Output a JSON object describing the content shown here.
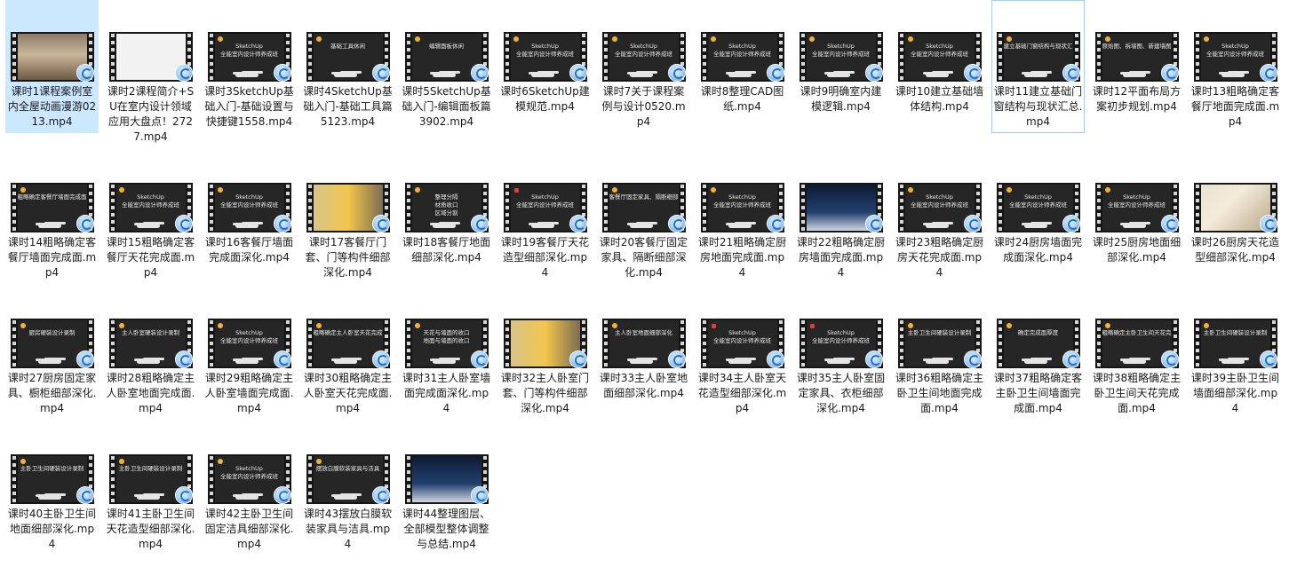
{
  "files": [
    {
      "name": "课时1课程案例室内全屋动画漫游0213.mp4",
      "thumb": "photo",
      "overlay": [],
      "badge_icon": "video-overlay-icon",
      "selected": true
    },
    {
      "name": "课时2课程简介+SU在室内设计领域应用大盘点！2727.mp4",
      "thumb": "web",
      "overlay": [],
      "badge_icon": "video-overlay-icon"
    },
    {
      "name": "课时3SketchUp基础入门-基础设置与快捷键1558.mp4",
      "thumb": "dark",
      "overlay": [
        "SketchUp",
        "全能室内设计师养成班"
      ],
      "badge_icon": "video-overlay-icon"
    },
    {
      "name": "课时4SketchUp基础入门-基础工具篇5123.mp4",
      "thumb": "dark",
      "overlay": [
        "基础工具休闲"
      ],
      "badge_icon": "video-overlay-icon"
    },
    {
      "name": "课时5SketchUp基础入门-编辑面板篇3902.mp4",
      "thumb": "dark",
      "overlay": [
        "编辑面板休闲"
      ],
      "badge_icon": "video-overlay-icon"
    },
    {
      "name": "课时6SketchUp建模规范.mp4",
      "thumb": "dark",
      "overlay": [
        "SketchUp",
        "全能室内设计师养成班"
      ],
      "badge_icon": "video-overlay-icon"
    },
    {
      "name": "课时7关于课程案例与设计0520.mp4",
      "thumb": "dark",
      "overlay": [
        "SketchUp",
        "全能室内设计师养成班"
      ],
      "badge_icon": "video-overlay-icon"
    },
    {
      "name": "课时8整理CAD图纸.mp4",
      "thumb": "dark",
      "overlay": [
        "SketchUp",
        "全能室内设计师养成班"
      ],
      "badge_icon": "video-overlay-icon"
    },
    {
      "name": "课时9明确室内建模逻辑.mp4",
      "thumb": "dark",
      "overlay": [
        "SketchUp",
        "全能室内设计师养成班"
      ],
      "badge_icon": "video-overlay-icon"
    },
    {
      "name": "课时10建立基础墙体结构.mp4",
      "thumb": "dark",
      "overlay": [
        "SketchUp",
        "全能室内设计师养成班"
      ],
      "badge_icon": "video-overlay-icon"
    },
    {
      "name": "课时11建立基础门窗结构与现状汇总.mp4",
      "thumb": "dark",
      "overlay": [
        "建立基础门窗结构与现状汇总"
      ],
      "badge_icon": "video-overlay-icon",
      "focused": true
    },
    {
      "name": "课时12平面布局方案初步规划.mp4",
      "thumb": "dark",
      "overlay": [
        "原始图、拆墙图、新建墙图"
      ],
      "badge_icon": "video-overlay-icon"
    },
    {
      "name": "课时13粗略确定客餐厅地面完成面.mp4",
      "thumb": "dark",
      "overlay": [
        "SketchUp",
        "全能室内设计师养成班"
      ],
      "badge_icon": "video-overlay-icon"
    },
    {
      "name": "课时14粗略确定客餐厅墙面完成面.mp4",
      "thumb": "dark",
      "overlay": [
        "粗略确定客餐厅墙面完成面"
      ],
      "badge_icon": "video-overlay-icon"
    },
    {
      "name": "课时15粗略确定客餐厅天花完成面.mp4",
      "thumb": "dark",
      "overlay": [
        "SketchUp",
        "全能室内设计师养成班"
      ],
      "badge_icon": "video-overlay-icon"
    },
    {
      "name": "课时16客餐厅墙面完成面深化.mp4",
      "thumb": "dark",
      "overlay": [
        "SketchUp",
        "全能室内设计师养成班"
      ],
      "badge_icon": "video-overlay-icon"
    },
    {
      "name": "课时17客餐厅门套、门等构件细部深化.mp4",
      "thumb": "photo3",
      "overlay": [],
      "badge_icon": "video-overlay-icon"
    },
    {
      "name": "课时18客餐厅地面细部深化.mp4",
      "thumb": "dark",
      "overlay": [
        "整理分隔",
        "材质收口",
        "区域分割"
      ],
      "badge_icon": "video-overlay-icon"
    },
    {
      "name": "课时19客餐厅天花造型细部深化.mp4",
      "thumb": "dark",
      "overlay": [
        "SketchUp",
        "全能室内设计师养成班"
      ],
      "badge_icon": "video-overlay-icon",
      "logo": true
    },
    {
      "name": "课时20客餐厅固定家具、隔断细部深化.mp4",
      "thumb": "dark",
      "overlay": [
        "客餐厅固定家具、隔断细部深化"
      ],
      "badge_icon": "video-overlay-icon"
    },
    {
      "name": "课时21粗略确定厨房地面完成面.mp4",
      "thumb": "dark",
      "overlay": [
        "SketchUp",
        "全能室内设计师养成班"
      ],
      "badge_icon": "video-overlay-icon"
    },
    {
      "name": "课时22粗略确定厨房墙面完成面.mp4",
      "thumb": "screen",
      "overlay": [],
      "badge_icon": "video-overlay-icon"
    },
    {
      "name": "课时23粗略确定厨房天花完成面.mp4",
      "thumb": "dark",
      "overlay": [
        "SketchUp",
        "全能室内设计师养成班"
      ],
      "badge_icon": "video-overlay-icon"
    },
    {
      "name": "课时24厨房墙面完成面深化.mp4",
      "thumb": "dark",
      "overlay": [
        "SketchUp",
        "全能室内设计师养成班"
      ],
      "badge_icon": "video-overlay-icon"
    },
    {
      "name": "课时25厨房地面细部深化.mp4",
      "thumb": "dark",
      "overlay": [
        "SketchUp",
        "全能室内设计师养成班"
      ],
      "badge_icon": "video-overlay-icon"
    },
    {
      "name": "课时26厨房天花造型细部深化.mp4",
      "thumb": "photo2",
      "overlay": [],
      "badge_icon": "video-overlay-icon"
    },
    {
      "name": "课时27厨房固定家具、橱柜细部深化.mp4",
      "thumb": "dark",
      "overlay": [
        "厨房硬装设计录制"
      ],
      "badge_icon": "video-overlay-icon"
    },
    {
      "name": "课时28粗略确定主人卧室地面完成面.mp4",
      "thumb": "dark",
      "overlay": [
        "主人卧室硬装设计录制"
      ],
      "badge_icon": "video-overlay-icon"
    },
    {
      "name": "课时29粗略确定主人卧室墙面完成面.mp4",
      "thumb": "dark",
      "overlay": [
        "SketchUp",
        "全能室内设计师养成班"
      ],
      "badge_icon": "video-overlay-icon"
    },
    {
      "name": "课时30粗略确定主人卧室天花完成面.mp4",
      "thumb": "dark",
      "overlay": [
        "粗略确定主人卧室天花完成面"
      ],
      "badge_icon": "video-overlay-icon"
    },
    {
      "name": "课时31主人卧室墙面完成面深化.mp4",
      "thumb": "dark",
      "overlay": [
        "天花与墙面的收口",
        "地面与墙面的收口"
      ],
      "badge_icon": "video-overlay-icon"
    },
    {
      "name": "课时32主人卧室门套、门等构件细部深化.mp4",
      "thumb": "photo3",
      "overlay": [],
      "badge_icon": "video-overlay-icon"
    },
    {
      "name": "课时33主人卧室地面细部深化.mp4",
      "thumb": "dark",
      "overlay": [
        "主人卧室地面细部深化"
      ],
      "badge_icon": "video-overlay-icon"
    },
    {
      "name": "课时34主人卧室天花造型细部深化.mp4",
      "thumb": "dark",
      "overlay": [
        "SketchUp",
        "全能室内设计师养成班"
      ],
      "badge_icon": "video-overlay-icon",
      "logo": true
    },
    {
      "name": "课时35主人卧室固定家具、衣柜细部深化.mp4",
      "thumb": "dark",
      "overlay": [
        "SketchUp",
        "全能室内设计师养成班"
      ],
      "badge_icon": "video-overlay-icon",
      "logo": true
    },
    {
      "name": "课时36粗略确定主卧卫生间地面完成面.mp4",
      "thumb": "dark",
      "overlay": [
        "主卧卫生间硬装设计录制"
      ],
      "badge_icon": "video-overlay-icon"
    },
    {
      "name": "课时37粗略确定客主卧卫生间墙面完成面.mp4",
      "thumb": "dark",
      "overlay": [
        "确定完成面厚度"
      ],
      "badge_icon": "video-overlay-icon"
    },
    {
      "name": "课时38粗略确定主卧卫生间天花完成面.mp4",
      "thumb": "dark",
      "overlay": [
        "粗略确定主卧卫生间天花完成面"
      ],
      "badge_icon": "video-overlay-icon"
    },
    {
      "name": "课时39主卧卫生间墙面细部深化.mp4",
      "thumb": "dark",
      "overlay": [
        "主卧卫生间硬装设计录制"
      ],
      "badge_icon": "video-overlay-icon"
    },
    {
      "name": "课时40主卧卫生间地面细部深化.mp4",
      "thumb": "dark",
      "overlay": [
        "主卧卫生间硬装设计录制"
      ],
      "badge_icon": "video-overlay-icon"
    },
    {
      "name": "课时41主卧卫生间天花造型细部深化.mp4",
      "thumb": "dark",
      "overlay": [
        "主卧卫生间硬装设计录制"
      ],
      "badge_icon": "video-overlay-icon"
    },
    {
      "name": "课时42主卧卫生间固定洁具细部深化.mp4",
      "thumb": "dark",
      "overlay": [
        "SketchUp",
        "全能室内设计师养成班"
      ],
      "badge_icon": "video-overlay-icon"
    },
    {
      "name": "课时43摆放白膜软装家具与洁具.mp4",
      "thumb": "dark",
      "overlay": [
        "摆放白膜软装家具与洁具"
      ],
      "badge_icon": "video-overlay-icon"
    },
    {
      "name": "课时44整理图层、全部模型整体调整与总结.mp4",
      "thumb": "screen",
      "overlay": [],
      "badge_icon": "video-overlay-icon"
    }
  ],
  "colors": {
    "selection": "#cce8ff",
    "focus_border": "#99d1ff",
    "thumb_bg": "#161616",
    "overlay_text": "#e8e8e8",
    "label_text": "#1a1a1a"
  }
}
